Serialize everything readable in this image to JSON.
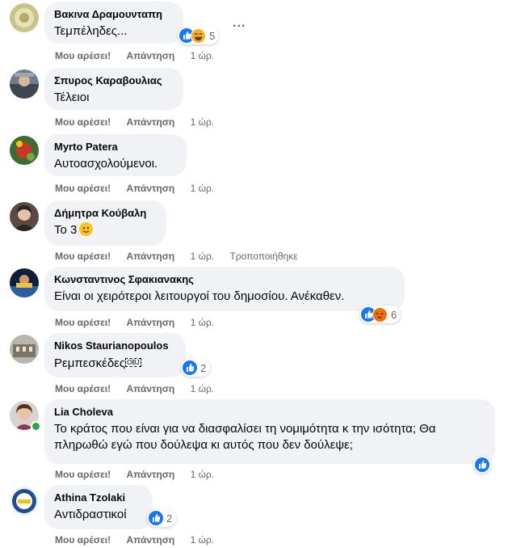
{
  "labels": {
    "like": "Μου αρέσει!",
    "reply": "Απάντηση",
    "time": "1 ώρ."
  },
  "colors": {
    "like": "#1877f2",
    "bubble": "#f0f2f5",
    "meta": "#65676b",
    "online": "#31a24c"
  },
  "comments": [
    {
      "author": "Βακινα Δραμουνταπη",
      "text": "Τεμπέληδες...",
      "reactions": [
        "like",
        "haha"
      ],
      "count": "5",
      "more": "..."
    },
    {
      "author": "Σπυρος Καραβουλιας",
      "text": "Τέλειοι"
    },
    {
      "author": "Myrto Patera",
      "text": "Αυτοασχολούμενοι."
    },
    {
      "author": "Δήμητρα Κούβαλη",
      "text": "Το 3",
      "emoji": "smile-emoji",
      "edited": "Τροποποιήθηκε"
    },
    {
      "author": "Κωνσταντινος Σφακιανακης",
      "text": "Είναι οι χειρότεροι λειτουργοί του δημοσίου. Ανέκαθεν.",
      "reactions": [
        "like",
        "angry"
      ],
      "count": "6"
    },
    {
      "author": "Nikos Staurianopoulos",
      "text": "Ρεμπεσκέδες",
      "obj": "OBJ",
      "reactions": [
        "like"
      ],
      "count": "2"
    },
    {
      "author": "Lia Choleva",
      "text": "Το κράτος που είναι για να διασφαλίσει τη νομιμότητα κ την ισότητα; Θα πληρωθώ εγώ που δούλεψα κι αυτός που δεν δούλεψε;",
      "reactions": [
        "like"
      ],
      "online": true
    },
    {
      "author": "Athina Tzolaki",
      "text": "Αντιδραστικοί",
      "reactions": [
        "like"
      ],
      "count": "2"
    }
  ]
}
